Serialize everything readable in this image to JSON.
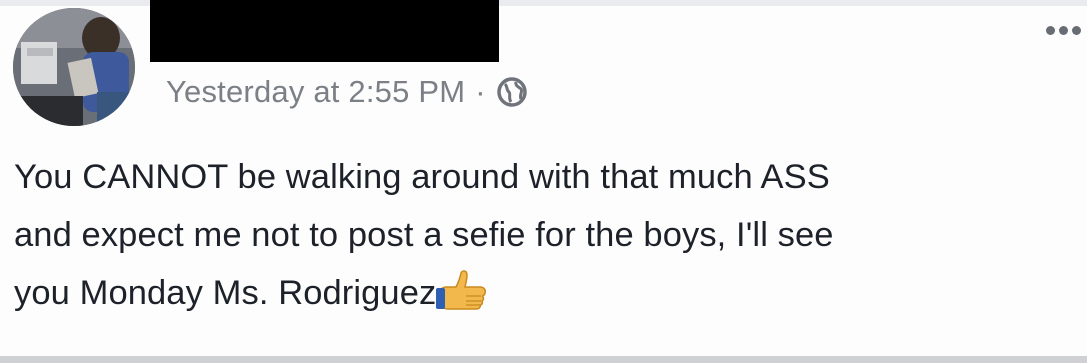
{
  "post": {
    "author_name_redacted": true,
    "timestamp": "Yesterday at 2:55 PM",
    "separator": "·",
    "privacy_icon": "globe-icon",
    "menu_icon": "more-options-icon",
    "text_lines": [
      "You CANNOT be walking around with that much ASS",
      "and expect me not to post a sefie for the boys, I'll see",
      "you Monday Ms. Rodriguez"
    ],
    "trailing_emoji": "thumbs-up-emoji"
  },
  "colors": {
    "text": "#1d2129",
    "meta_text": "#7b7f86",
    "redaction": "#000000",
    "background": "#fdfdfd"
  }
}
